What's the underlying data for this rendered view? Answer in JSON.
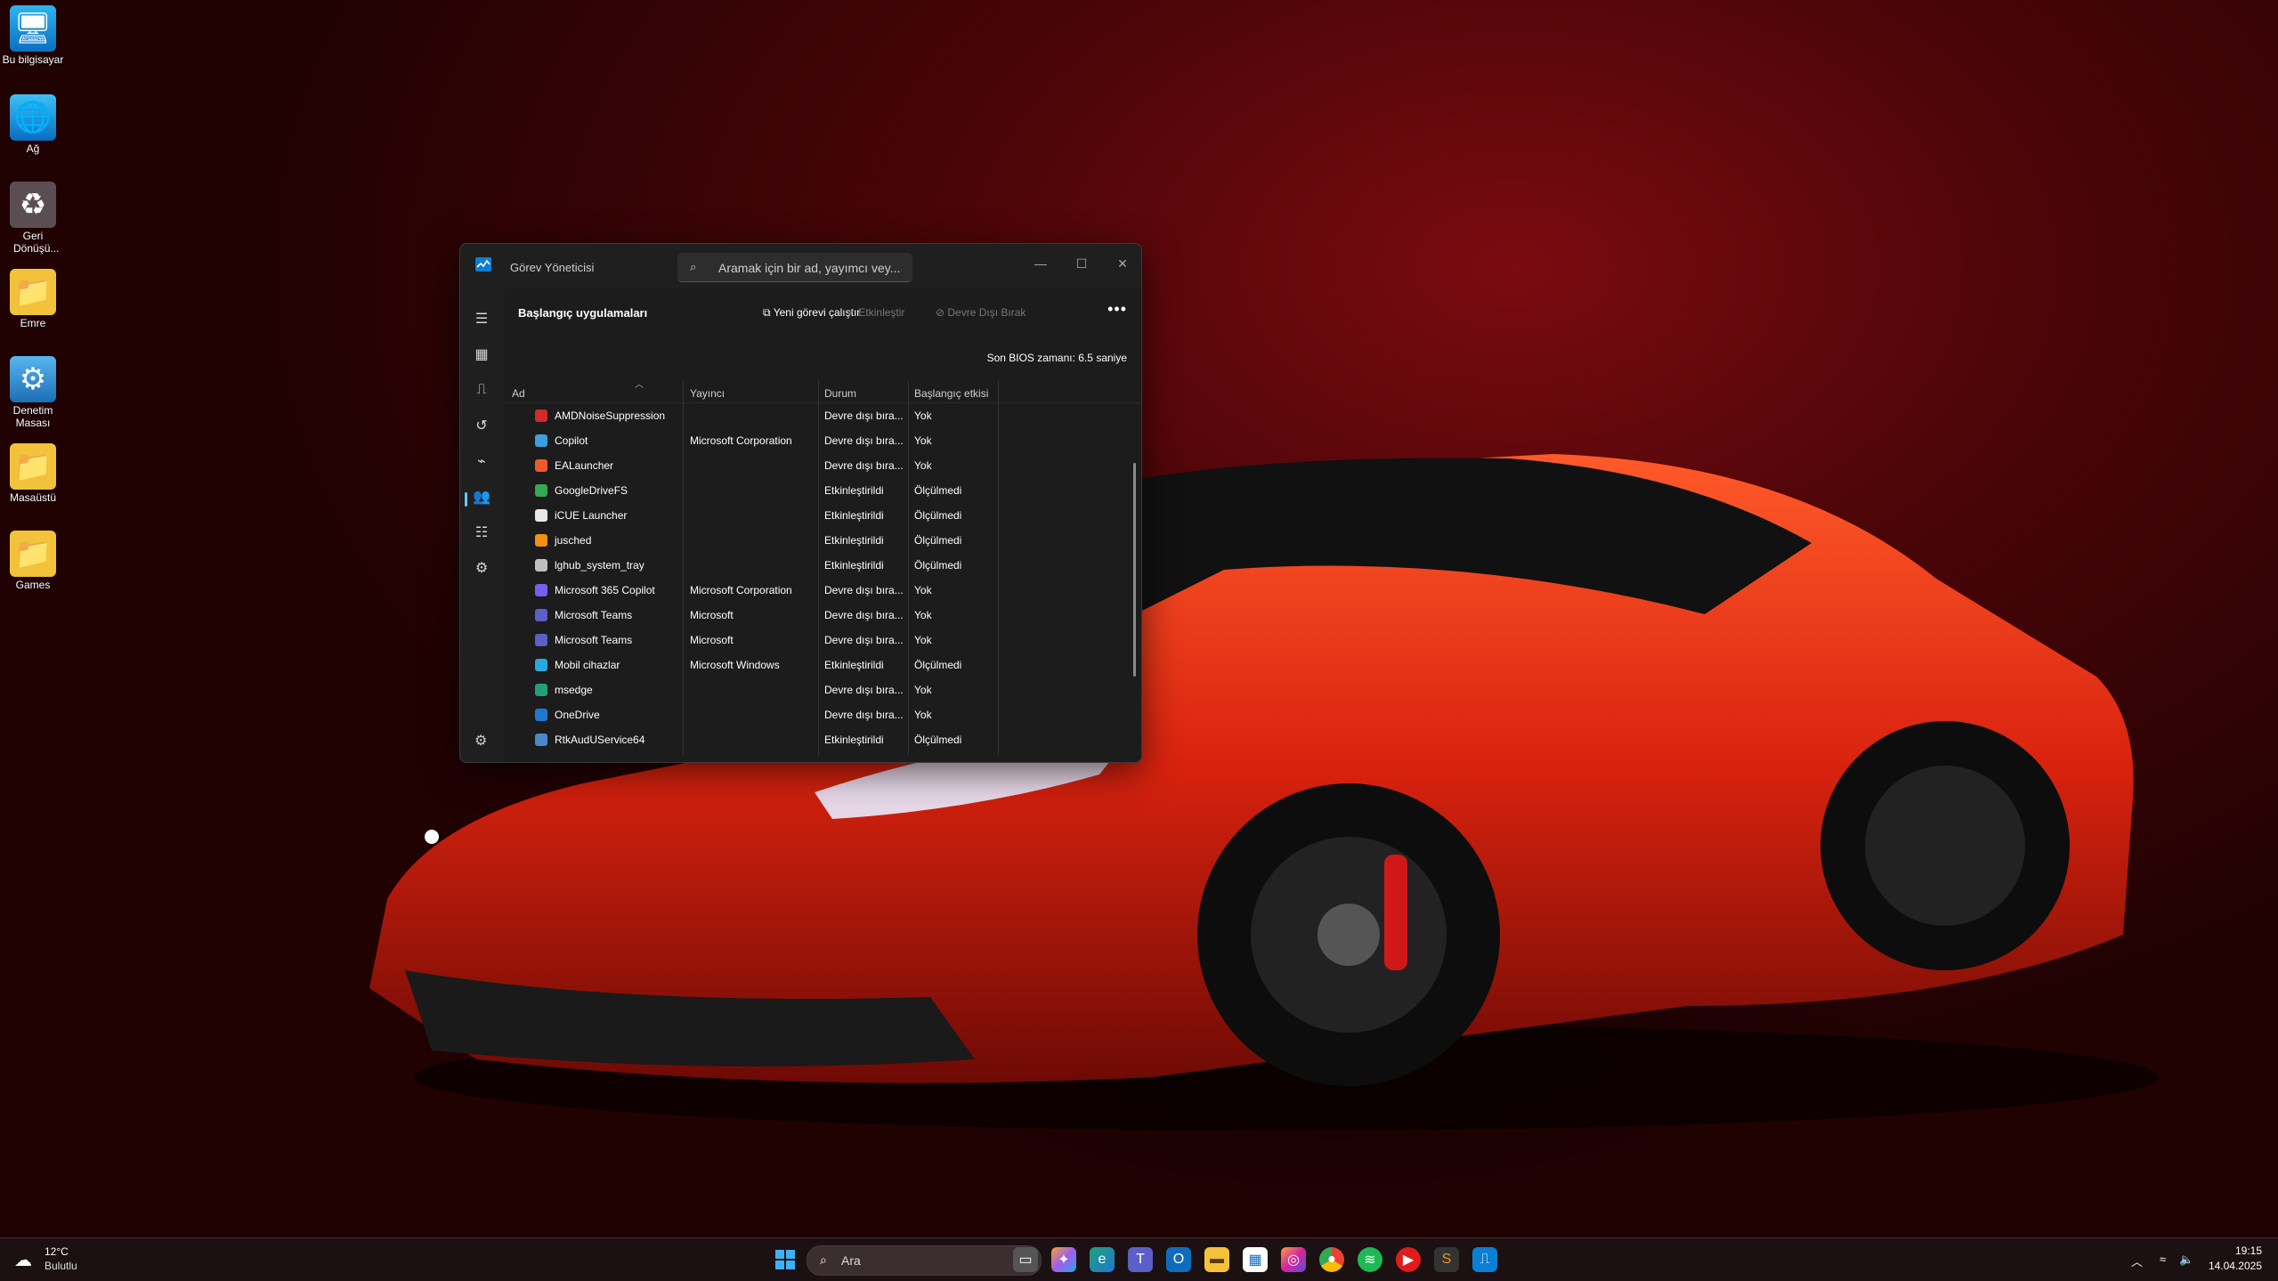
{
  "desktop": {
    "icons": [
      {
        "label": "Bu bilgisayar",
        "icon": "monitor-icon"
      },
      {
        "label": "Ağ",
        "icon": "network-icon"
      },
      {
        "label": "Geri Dönüşü...",
        "icon": "recycle-bin-icon"
      },
      {
        "label": "Emre",
        "icon": "folder-icon"
      },
      {
        "label": "Denetim Masası",
        "icon": "control-panel-icon"
      },
      {
        "label": "Masaüstü",
        "icon": "folder-icon"
      },
      {
        "label": "Games",
        "icon": "folder-icon"
      }
    ]
  },
  "task_manager": {
    "title": "Görev Yöneticisi",
    "search_placeholder": "Aramak için bir ad, yayımcı vey...",
    "page_title": "Başlangıç uygulamaları",
    "toolbar": {
      "run_new_task": "Yeni görevi çalıştır",
      "enable": "Etkinleştir",
      "disable": "Devre Dışı Bırak",
      "more": "•••"
    },
    "bios_label": "Son BIOS zamanı:",
    "bios_value": "6.5 saniye",
    "columns": {
      "name": "Ad",
      "publisher": "Yayıncı",
      "status": "Durum",
      "impact": "Başlangıç etkisi"
    },
    "rows": [
      {
        "name": "AMDNoiseSuppression",
        "publisher": "",
        "status": "Devre dışı bıra...",
        "impact": "Yok",
        "color": "#d12a2a"
      },
      {
        "name": "Copilot",
        "publisher": "Microsoft Corporation",
        "status": "Devre dışı bıra...",
        "impact": "Yok",
        "color": "#3aa0e0"
      },
      {
        "name": "EALauncher",
        "publisher": "",
        "status": "Devre dışı bıra...",
        "impact": "Yok",
        "color": "#f05a28"
      },
      {
        "name": "GoogleDriveFS",
        "publisher": "",
        "status": "Etkinleştirildi",
        "impact": "Ölçülmedi",
        "color": "#34a853"
      },
      {
        "name": "iCUE Launcher",
        "publisher": "",
        "status": "Etkinleştirildi",
        "impact": "Ölçülmedi",
        "color": "#e8e8e8"
      },
      {
        "name": "jusched",
        "publisher": "",
        "status": "Etkinleştirildi",
        "impact": "Ölçülmedi",
        "color": "#f29111"
      },
      {
        "name": "lghub_system_tray",
        "publisher": "",
        "status": "Etkinleştirildi",
        "impact": "Ölçülmedi",
        "color": "#bfbfbf"
      },
      {
        "name": "Microsoft 365 Copilot",
        "publisher": "Microsoft Corporation",
        "status": "Devre dışı bıra...",
        "impact": "Yok",
        "color": "#7a5cf0"
      },
      {
        "name": "Microsoft Teams",
        "publisher": "Microsoft",
        "status": "Devre dışı bıra...",
        "impact": "Yok",
        "color": "#5b5fc7"
      },
      {
        "name": "Microsoft Teams",
        "publisher": "Microsoft",
        "status": "Devre dışı bıra...",
        "impact": "Yok",
        "color": "#5b5fc7"
      },
      {
        "name": "Mobil cihazlar",
        "publisher": "Microsoft Windows",
        "status": "Etkinleştirildi",
        "impact": "Ölçülmedi",
        "color": "#2aa7e0"
      },
      {
        "name": "msedge",
        "publisher": "",
        "status": "Devre dışı bıra...",
        "impact": "Yok",
        "color": "#1fa07a"
      },
      {
        "name": "OneDrive",
        "publisher": "",
        "status": "Devre dışı bıra...",
        "impact": "Yok",
        "color": "#1f78d1"
      },
      {
        "name": "RtkAudUService64",
        "publisher": "",
        "status": "Etkinleştirildi",
        "impact": "Ölçülmedi",
        "color": "#4a88c9"
      }
    ]
  },
  "taskbar": {
    "weather_temp": "12°C",
    "weather_desc": "Bulutlu",
    "search_label": "Ara",
    "time": "19:15",
    "date": "14.04.2025"
  }
}
